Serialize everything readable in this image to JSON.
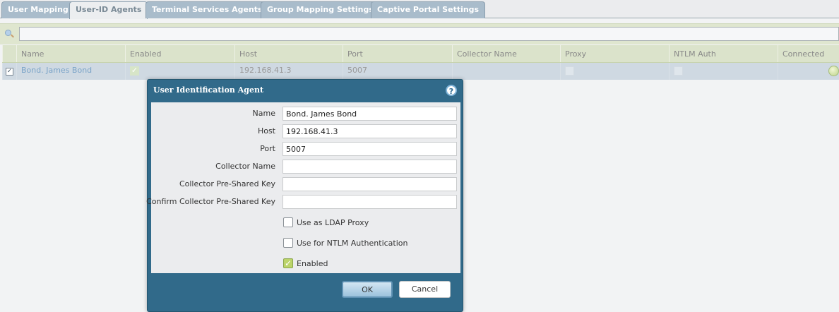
{
  "tabs": [
    {
      "label": "User Mapping"
    },
    {
      "label": "User-ID Agents",
      "active": true
    },
    {
      "label": "Terminal Services Agents"
    },
    {
      "label": "Group Mapping Settings"
    },
    {
      "label": "Captive Portal Settings"
    }
  ],
  "search": {
    "value": "",
    "icon": "search-icon"
  },
  "table": {
    "columns": [
      "Name",
      "Enabled",
      "Host",
      "Port",
      "Collector Name",
      "Proxy",
      "NTLM Auth",
      "Connected"
    ],
    "rows": [
      {
        "selected": true,
        "name": "Bond. James Bond",
        "enabled": true,
        "host": "192.168.41.3",
        "port": "5007",
        "collector_name": "",
        "proxy": false,
        "ntlm_auth": false,
        "connected": true
      }
    ]
  },
  "dialog": {
    "title": "User Identification Agent",
    "fields": [
      {
        "label": "Name",
        "value": "Bond. James Bond"
      },
      {
        "label": "Host",
        "value": "192.168.41.3"
      },
      {
        "label": "Port",
        "value": "5007"
      },
      {
        "label": "Collector Name",
        "value": ""
      },
      {
        "label": "Collector Pre-Shared Key",
        "value": ""
      },
      {
        "label": "Confirm Collector Pre-Shared Key",
        "value": ""
      }
    ],
    "checkboxes": [
      {
        "label": "Use as LDAP Proxy",
        "checked": false
      },
      {
        "label": "Use for NTLM Authentication",
        "checked": false
      },
      {
        "label": "Enabled",
        "checked": true
      }
    ],
    "ok_label": "OK",
    "cancel_label": "Cancel"
  },
  "colors": {
    "dialog": "#316a8a",
    "header": "#dbe3cb",
    "selected_row": "#cfd9e2"
  }
}
